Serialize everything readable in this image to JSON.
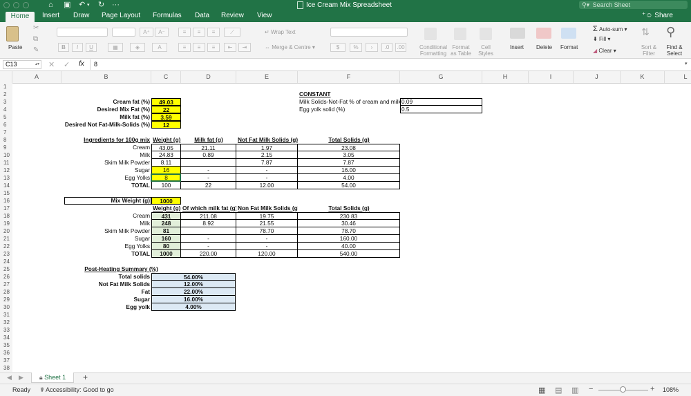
{
  "window": {
    "title": "Ice Cream Mix Spreadsheet",
    "search_placeholder": "Search Sheet",
    "share_label": "Share"
  },
  "tabs": [
    "Home",
    "Insert",
    "Draw",
    "Page Layout",
    "Formulas",
    "Data",
    "Review",
    "View"
  ],
  "ribbon": {
    "paste": "Paste",
    "wrap_text": "Wrap Text",
    "merge_centre": "Merge & Centre",
    "percent": "%",
    "conditional_formatting": [
      "Conditional",
      "Formatting"
    ],
    "format_as_table": [
      "Format",
      "as Table"
    ],
    "cell_styles": [
      "Cell",
      "Styles"
    ],
    "insert": "Insert",
    "delete": "Delete",
    "format": "Format",
    "autosum": "Auto-sum",
    "fill": "Fill",
    "clear": "Clear",
    "sort_filter": [
      "Sort &",
      "Filter"
    ],
    "find_select": [
      "Find &",
      "Select"
    ],
    "bold": "B",
    "italic": "I",
    "underline": "U"
  },
  "formula_bar": {
    "name_box": "C13",
    "fx": "fx",
    "value": "8"
  },
  "columns": [
    "A",
    "B",
    "C",
    "D",
    "E",
    "F",
    "G",
    "H",
    "I",
    "J",
    "K",
    "L"
  ],
  "rows": [
    "1",
    "2",
    "3",
    "4",
    "5",
    "6",
    "7",
    "8",
    "9",
    "10",
    "11",
    "12",
    "13",
    "14",
    "15",
    "16",
    "17",
    "18",
    "19",
    "20",
    "21",
    "22",
    "23",
    "24",
    "25",
    "26",
    "27",
    "28",
    "29",
    "30",
    "31",
    "32",
    "33",
    "34",
    "35",
    "36",
    "37",
    "38"
  ],
  "inputs": {
    "labels": [
      "Cream fat (%)",
      "Desired Mix Fat (%)",
      "Milk fat (%)",
      "Desired Not Fat-Milk-Solids (%)"
    ],
    "values": [
      "49.03",
      "22",
      "3.59",
      "12"
    ]
  },
  "constant": {
    "title": "CONSTANT",
    "labels": [
      "Milk Solids-Not-Fat % of cream and milk",
      "Egg yolk solid (%)"
    ],
    "values": [
      "0.09",
      "0.5"
    ]
  },
  "table1": {
    "headers": [
      "Ingredients for 100g mix",
      "Weight (g)",
      "Milk fat (g)",
      "Not Fat Milk Solids (g)",
      "Total Solids (g)"
    ],
    "rows": [
      [
        "Cream",
        "43.05",
        "21.11",
        "1.97",
        "23.08"
      ],
      [
        "Milk",
        "24.83",
        "0.89",
        "2.15",
        "3.05"
      ],
      [
        "Skim Milk Powder",
        "8.11",
        "",
        "7.87",
        "7.87"
      ],
      [
        "Sugar",
        "16",
        "-",
        "-",
        "16.00"
      ],
      [
        "Egg Yolks",
        "8",
        "-",
        "-",
        "4.00"
      ],
      [
        "TOTAL",
        "100",
        "22",
        "12.00",
        "54.00"
      ]
    ]
  },
  "mix_weight": {
    "label": "Mix Weight (g)",
    "value": "1000"
  },
  "table2": {
    "headers": [
      "Weight (g)",
      "Of which milk fat (g)",
      "Non Fat Milk Solids (g)",
      "Total Solids (g)"
    ],
    "rows": [
      [
        "Cream",
        "431",
        "211.08",
        "19.75",
        "230.83"
      ],
      [
        "Milk",
        "248",
        "8.92",
        "21.55",
        "30.46"
      ],
      [
        "Skim Milk Powder",
        "81",
        "",
        "78.70",
        "78.70"
      ],
      [
        "Sugar",
        "160",
        "-",
        "-",
        "160.00"
      ],
      [
        "Egg Yolks",
        "80",
        "-",
        "-",
        "40.00"
      ],
      [
        "TOTAL",
        "1000",
        "220.00",
        "120.00",
        "540.00"
      ]
    ]
  },
  "summary": {
    "title": "Post-Heating Summary (%)",
    "rows": [
      [
        "Total solids",
        "54.00%"
      ],
      [
        "Not Fat Milk Solids",
        "12.00%"
      ],
      [
        "Fat",
        "22.00%"
      ],
      [
        "Sugar",
        "16.00%"
      ],
      [
        "Egg yolk",
        "4.00%"
      ]
    ]
  },
  "sheet_tabs": {
    "active": "Sheet 1",
    "add": "+"
  },
  "status": {
    "ready": "Ready",
    "accessibility": "Accessibility: Good to go",
    "zoom": "108%"
  },
  "colors": {
    "excel_green": "#217346",
    "input_yellow": "#ffff00",
    "mix_green": "#e2efda",
    "summary_blue": "#dce9f4"
  }
}
